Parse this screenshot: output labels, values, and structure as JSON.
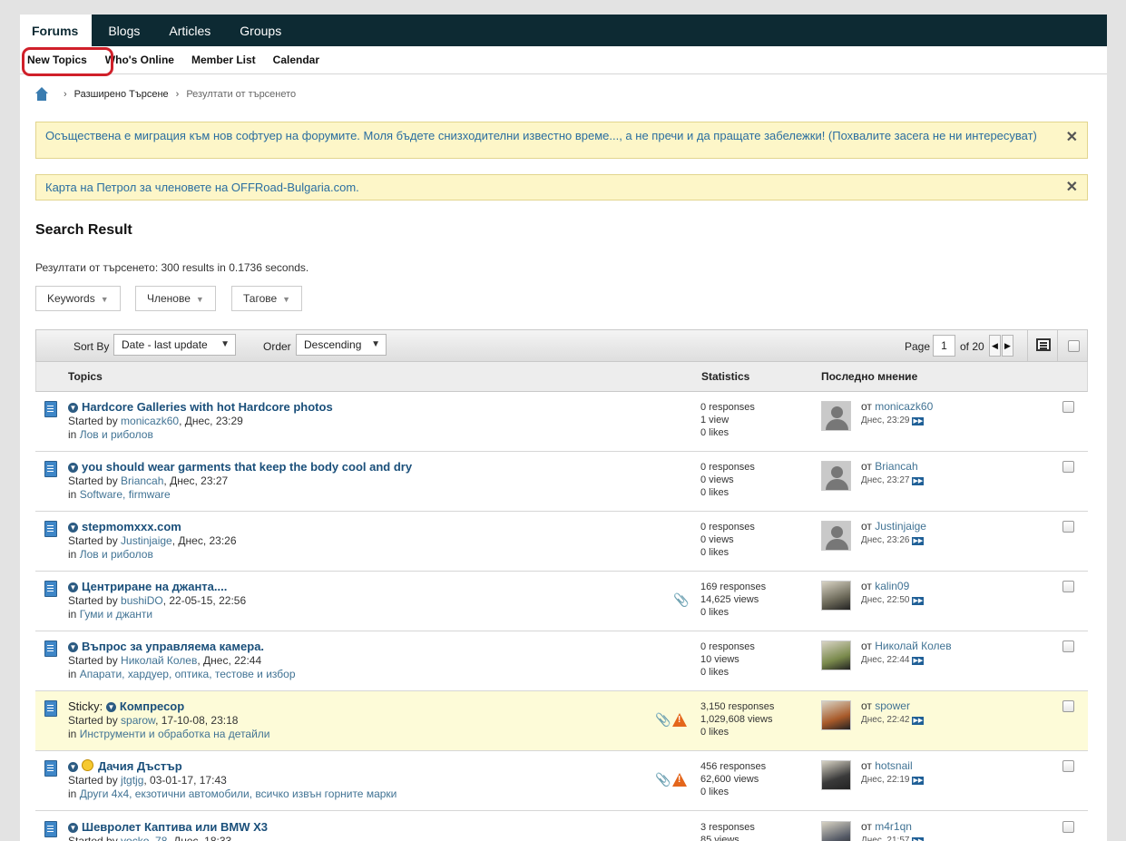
{
  "nav": {
    "tabs": [
      "Forums",
      "Blogs",
      "Articles",
      "Groups"
    ]
  },
  "subnav": {
    "items": [
      "New Topics",
      "Who's Online",
      "Member List",
      "Calendar"
    ]
  },
  "breadcrumb": {
    "items": [
      "Разширено Търсене",
      "Резултати от търсенето"
    ]
  },
  "notices": [
    {
      "text": "Осъществена е миграция към нов софтуер на форумите. Моля бъдете снизходителни известно време..., а не пречи и да пращате забележки! (Похвалите засега не ни интересуват)",
      "close": "✕"
    },
    {
      "text": "Карта на Петрол за членовете на OFFRoad-Bulgaria.com.",
      "close": "✕"
    }
  ],
  "search": {
    "title": "Search Result",
    "summary": "Резултати от търсенето: 300 results in 0.1736 seconds.",
    "filters": [
      "Keywords",
      "Членове",
      "Тагове"
    ]
  },
  "toolbar": {
    "sort_label": "Sort By",
    "sort_value": "Date - last update",
    "order_label": "Order",
    "order_value": "Descending",
    "page_label": "Page",
    "page_value": "1",
    "page_total": "of 20"
  },
  "columns": {
    "topics": "Topics",
    "stats": "Statistics",
    "last": "Последно мнение"
  },
  "topics": [
    {
      "prefix": "",
      "smiley": false,
      "title": "Hardcore Galleries with hot Hardcore photos",
      "started_prefix": "Started by ",
      "author": "monicazk60",
      "date": ", Днес, 23:29",
      "in_prefix": "in ",
      "category": "Лов и риболов",
      "responses": "0 responses",
      "views": "1 view",
      "likes": "0 likes",
      "last_prefix": "от ",
      "last_user": "monicazk60",
      "last_date": "Днес, 23:29",
      "clip": false,
      "warn": false,
      "sticky": false,
      "avatar": "default"
    },
    {
      "prefix": "",
      "smiley": false,
      "title": "you should wear garments that keep the body cool and dry",
      "started_prefix": "Started by ",
      "author": "Briancah",
      "date": ", Днес, 23:27",
      "in_prefix": "in ",
      "category": "Software, firmware",
      "responses": "0 responses",
      "views": "0 views",
      "likes": "0 likes",
      "last_prefix": "от ",
      "last_user": "Briancah",
      "last_date": "Днес, 23:27",
      "clip": false,
      "warn": false,
      "sticky": false,
      "avatar": "default"
    },
    {
      "prefix": "",
      "smiley": false,
      "title": "stepmomxxx.com",
      "started_prefix": "Started by ",
      "author": "Justinjaige",
      "date": ", Днес, 23:26",
      "in_prefix": "in ",
      "category": "Лов и риболов",
      "responses": "0 responses",
      "views": "0 views",
      "likes": "0 likes",
      "last_prefix": "от ",
      "last_user": "Justinjaige",
      "last_date": "Днес, 23:26",
      "clip": false,
      "warn": false,
      "sticky": false,
      "avatar": "default"
    },
    {
      "prefix": "",
      "smiley": false,
      "title": "Центриране на джанта....",
      "started_prefix": "Started by ",
      "author": "bushiDO",
      "date": ", 22-05-15, 22:56",
      "in_prefix": "in ",
      "category": "Гуми и джанти",
      "responses": "169 responses",
      "views": "14,625 views",
      "likes": "0 likes",
      "last_prefix": "от ",
      "last_user": "kalin09",
      "last_date": "Днес, 22:50",
      "clip": true,
      "warn": false,
      "sticky": false,
      "avatar": "photo",
      "avatar_color": "#6d6a5a"
    },
    {
      "prefix": "",
      "smiley": false,
      "title": "Въпрос за управляема камера.",
      "started_prefix": "Started by ",
      "author": "Николай Колев",
      "date": ", Днес, 22:44",
      "in_prefix": "in ",
      "category": "Апарати, хардуер, оптика, тестове и избор",
      "responses": "0 responses",
      "views": "10 views",
      "likes": "0 likes",
      "last_prefix": "от ",
      "last_user": "Николай Колев",
      "last_date": "Днес, 22:44",
      "clip": false,
      "warn": false,
      "sticky": false,
      "avatar": "photo",
      "avatar_color": "#7a8a4c"
    },
    {
      "prefix": "Sticky: ",
      "smiley": false,
      "title": "Компресор",
      "started_prefix": "Started by ",
      "author": "sparow",
      "date": ", 17-10-08, 23:18",
      "in_prefix": "in ",
      "category": "Инструменти и обработка на детайли",
      "responses": "3,150 responses",
      "views": "1,029,608 views",
      "likes": "0 likes",
      "last_prefix": "от ",
      "last_user": "spower",
      "last_date": "Днес, 22:42",
      "clip": true,
      "warn": true,
      "sticky": true,
      "avatar": "photo",
      "avatar_color": "#a85a2a"
    },
    {
      "prefix": "",
      "smiley": true,
      "title": "Дачия Дъстър",
      "started_prefix": "Started by ",
      "author": "jtgtjg",
      "date": ", 03-01-17, 17:43",
      "in_prefix": "in ",
      "category": "Други 4x4, екзотични автомобили, всичко извън горните марки",
      "responses": "456 responses",
      "views": "62,600 views",
      "likes": "0 likes",
      "last_prefix": "от ",
      "last_user": "hotsnail",
      "last_date": "Днес, 22:19",
      "clip": true,
      "warn": true,
      "sticky": false,
      "avatar": "photo",
      "avatar_color": "#3a3a3a"
    },
    {
      "prefix": "",
      "smiley": false,
      "title": "Шевролет Каптива или BMW X3",
      "started_prefix": "Started by ",
      "author": "yocko_78",
      "date": ", Днес, 18:33",
      "in_prefix": "in ",
      "category": "",
      "responses": "3 responses",
      "views": "85 views",
      "likes": "",
      "last_prefix": "от ",
      "last_user": "m4r1qn",
      "last_date": "Днес, 21:57",
      "clip": false,
      "warn": false,
      "sticky": false,
      "avatar": "photo",
      "avatar_color": "#555a66"
    }
  ],
  "icons": {
    "home": "home-icon",
    "topic": "topic-document-icon",
    "first_unread": "go-first-unread-icon",
    "attachment": "paperclip-icon",
    "hot": "warning-icon",
    "go_to_post": "go-to-last-post-icon",
    "moderation": "inline-moderation-icon"
  },
  "colors": {
    "nav_bg": "#0d2a33",
    "link": "#417394",
    "notice_bg": "#fdf6c8",
    "sticky_bg": "#fdfbd8",
    "highlight": "#d0202a"
  }
}
